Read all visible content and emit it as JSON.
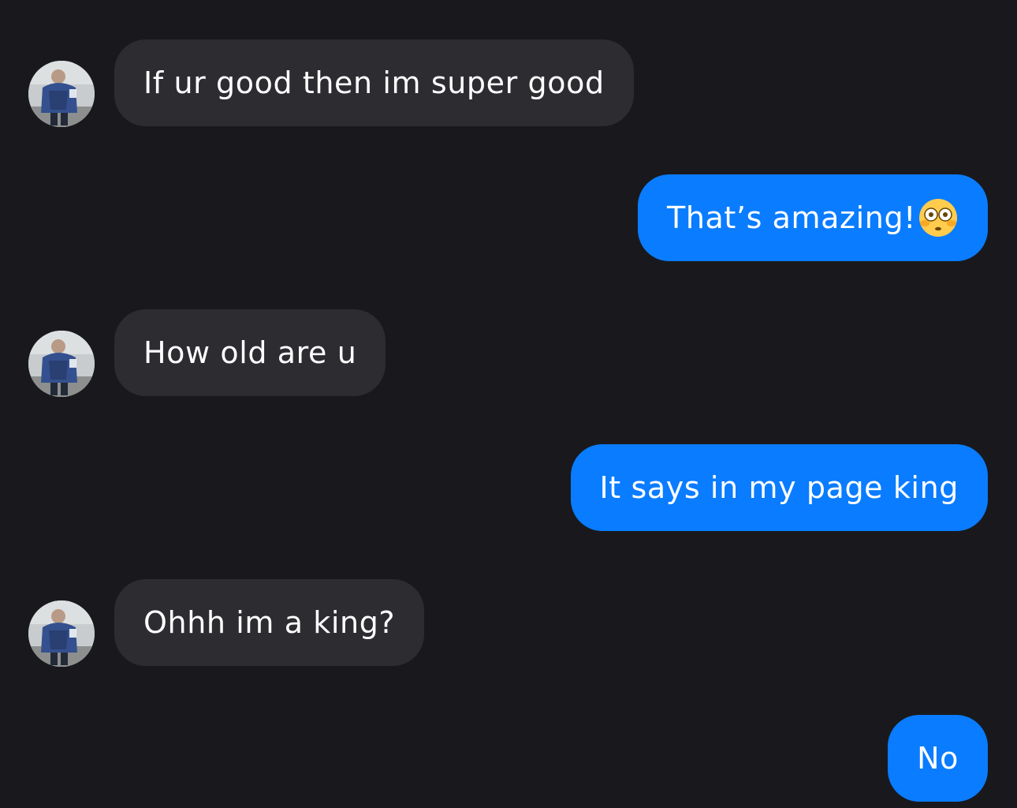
{
  "conversation": {
    "messages": [
      {
        "direction": "incoming",
        "text": "If ur good then im super good"
      },
      {
        "direction": "outgoing",
        "text": "That’s amazing!",
        "emoji": "flushed-face-emoji"
      },
      {
        "direction": "incoming",
        "text": "How old are u"
      },
      {
        "direction": "outgoing",
        "text": "It says in my page king"
      },
      {
        "direction": "incoming",
        "text": "Ohhh im a king?"
      },
      {
        "direction": "outgoing",
        "text": "No"
      }
    ]
  },
  "colors": {
    "background": "#19191d",
    "incoming_bubble": "#2c2c31",
    "outgoing_bubble": "#0a7cff",
    "text": "#ffffff"
  }
}
